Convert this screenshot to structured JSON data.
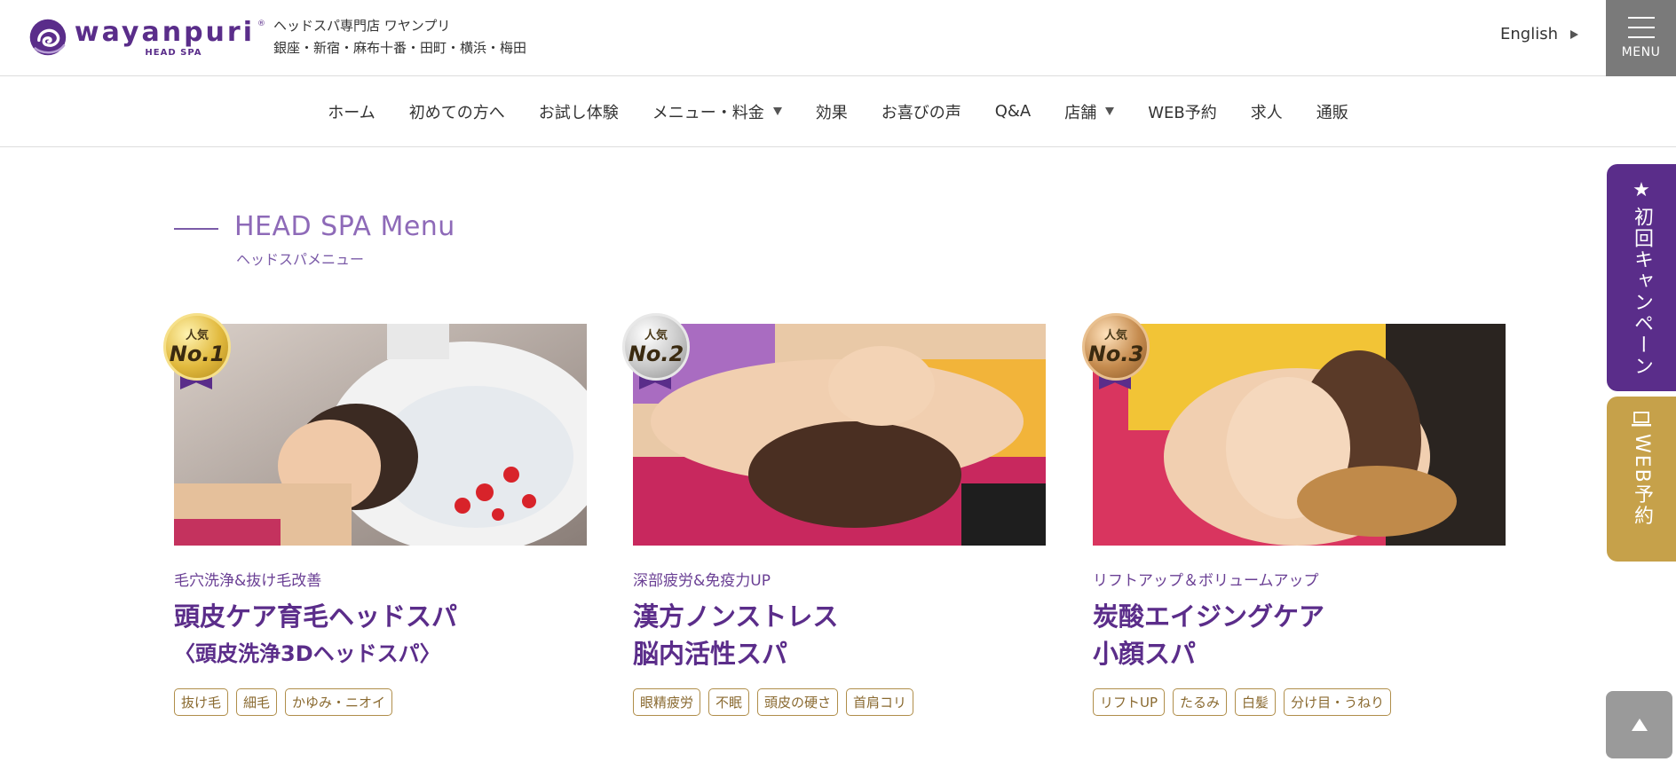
{
  "header": {
    "logo_word": "wayanpuri",
    "logo_sub": "HEAD SPA",
    "logo_reg": "®",
    "shop_line1": "ヘッドスパ専門店 ワヤンプリ",
    "shop_line2": "銀座・新宿・麻布十番・田町・横浜・梅田",
    "lang_label": "English",
    "menu_label": "MENU"
  },
  "nav": {
    "items": [
      {
        "label": "ホーム"
      },
      {
        "label": "初めての方へ"
      },
      {
        "label": "お試し体験"
      },
      {
        "label": "メニュー・料金"
      },
      {
        "label": "効果"
      },
      {
        "label": "お喜びの声"
      },
      {
        "label": "Q&A"
      },
      {
        "label": "店舗"
      },
      {
        "label": "WEB予約"
      },
      {
        "label": "求人"
      },
      {
        "label": "通販"
      }
    ]
  },
  "section": {
    "title": "HEAD SPA Menu",
    "subtitle": "ヘッドスパメニュー"
  },
  "cards": [
    {
      "badge_small": "人気",
      "badge_big": "No.1",
      "category": "毛穴洗浄&抜け毛改善",
      "title_line1": "頭皮ケア育毛ヘッドスパ",
      "title_line2": "〈頭皮洗浄3Dヘッドスパ〉",
      "tags": [
        "抜け毛",
        "細毛",
        "かゆみ・ニオイ"
      ]
    },
    {
      "badge_small": "人気",
      "badge_big": "No.2",
      "category": "深部疲労&免疫力UP",
      "title_line1": "漢方ノンストレス",
      "title_line2": "脳内活性スパ",
      "tags": [
        "眼精疲労",
        "不眠",
        "頭皮の硬さ",
        "首肩コリ"
      ]
    },
    {
      "badge_small": "人気",
      "badge_big": "No.3",
      "category": "リフトアップ＆ボリュームアップ",
      "title_line1": "炭酸エイジングケア",
      "title_line2": "小顔スパ",
      "tags": [
        "リフトUP",
        "たるみ",
        "白髪",
        "分け目・うねり"
      ]
    }
  ],
  "side": {
    "campaign_icon": "★",
    "campaign_label": "初回キャンペーン",
    "web_icon": "💻",
    "web_label": "WEB予約"
  },
  "colors": {
    "brand_purple": "#5a2d8a",
    "gold": "#c6a14a",
    "grey": "#7a7a7a"
  }
}
